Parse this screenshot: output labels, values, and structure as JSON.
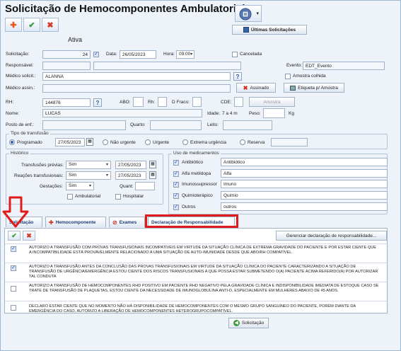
{
  "window": {
    "title": "Solicitação de Hemocomponentes Ambulatorial"
  },
  "toolbar": {
    "add_glyph": "✚",
    "confirm_glyph": "✔",
    "cancel_glyph": "✖",
    "last_requests_label": "Últimas Solicitações"
  },
  "status": "Ativa",
  "form": {
    "solicitacao_label": "Solicitação:",
    "solicitacao_value": "24",
    "data_label": "Data:",
    "data_value": "26/05/2023",
    "hora_label": "Hora:",
    "hora_value": "09:00",
    "cancelada_label": "Cancelada",
    "responsavel_label": "Responsável:",
    "evento_label": "Evento:",
    "evento_value": "EDT_Evento",
    "medico_solicit_label": "Médico solicit.:",
    "medico_solicit_value": "ALANNA",
    "amostra_colhida_label": "Amostra colhida",
    "medico_assin_label": "Médico assin.:",
    "assinado_label": "Assinado",
    "etiqueta_label": "Etiqueta p/ Amostra",
    "rh_label": "RH:",
    "rh_value": "144876",
    "abo_label": "ABO:",
    "rh2_label": "Rh:",
    "dfraco_label": "D Fraco:",
    "cde_label": "CDE:",
    "amostra_label": "Amostra",
    "nome_label": "Nome:",
    "nome_value": "LUCAS",
    "idade_label": "Idade:",
    "idade_value": "7 a 4 m",
    "peso_label": "Peso:",
    "peso_unit": "Kg",
    "posto_label": "Posto de enf.:",
    "quarto_label": "Quarto:",
    "leito_label": "Leito:"
  },
  "tipo_transfusao": {
    "title": "Tipo de transfusão",
    "programado_label": "Programado",
    "programado_date": "27/05/2023",
    "nao_urgente_label": "Não urgente",
    "urgente_label": "Urgente",
    "extrema_label": "Extrema urgência",
    "reserva_label": "Reserva"
  },
  "historico": {
    "title": "Histórico",
    "transfusoes_label": "Transfusões prévias:",
    "transfusoes_value": "Sim",
    "transfusoes_date": "27/05/2023",
    "reacoes_label": "Reações transfusionais:",
    "reacoes_value": "Sim",
    "reacoes_date": "27/05/2023",
    "gestacoes_label": "Gestações:",
    "gestacoes_value": "Sim",
    "quant_label": "Quant:",
    "ambulatorial_label": "Ambulatorial",
    "hospitalar_label": "Hospitalar"
  },
  "medicamentos": {
    "title": "Uso de medicamentos",
    "items": [
      {
        "label": "Antibiótico",
        "value": "Antibiótico",
        "checked": true
      },
      {
        "label": "Alfa metildopa",
        "value": "Alfa",
        "checked": true
      },
      {
        "label": "Imunossupressor",
        "value": "Imuno",
        "checked": true
      },
      {
        "label": "Quimioterápico",
        "value": "Quimio",
        "checked": true
      },
      {
        "label": "Outros",
        "value": "outros",
        "checked": true
      }
    ]
  },
  "tabs": [
    {
      "label": "Solicitação"
    },
    {
      "label": "Hemocomponente"
    },
    {
      "label": "Exames"
    },
    {
      "label": "Declaração de Responsabilidade"
    }
  ],
  "panel": {
    "gerenciar_label": "Gerenciar declaração de responsabilidade...",
    "declarations": [
      {
        "checked": true,
        "text": "AUTORIZO A TRANSFUSÃO COM PROVAS TRANSFUSIONAIS INCOMPATÍVEIS EM VIRTUDE DA SITUAÇÃO CLÍNICA DE EXTREMA GRAVIDADE DO PACIENTE E POR ESTAR CIENTE QUE A INCOMPATIBILIDADE ESTÁ PROVAVELMENTE RELACIONADO A UMA SITUAÇÃO DE AUTO-IMUNIDADE DESDE QUE ABO/RH COMPATÍVEL."
      },
      {
        "checked": true,
        "text": "AUTORIZO A TRANSFUSÃO ANTES DA CONCLUSÃO DAS PROVAS TRANSFUSIONAIS EM VIRTUDE DA SITUAÇÃO CLÍNICA DO PACIENTE CARACTERIZANDO A SITUAÇÃO DE TRANSFUSÃO DE URGÊNCIA/EMERGÊNCIA ESTOU CIENTE DOS RISCOS TRANSFUSIONAIS A QUE POSSA ESTAR SUBMETENDO O(A) PACIENTE ACIMA REFERIDO(A) POR AUTORIZAR TAL CONDUTA"
      },
      {
        "checked": false,
        "text": "AUTORIZO A TRANSFUSÃO DE HEMOCOMPONENTES RHD POSITIVO EM PACIENTE RHD NEGATIVO PELA GRAVIDADE CLÍNICA E INDISPONIBILIDADE IMEDIATA DE ESTOQUE CASO SE TRATE DE TRANSFUSÃO DE PLAQUETAS, ESTOU CIENTE DA NECESSIDADE DE IMUNOGLOBULINA ANTI-D, ESPECIALMENTE EM MULHERES ABAIXO DE 45 ANOS."
      },
      {
        "checked": false,
        "text": "DECLARO ESTAR CIENTE QUE NO MOMENTO NÃO HÁ DISPONIBILIDADE DE HEMOCOMPONENTES COM O MESMO GRUPO SANGUÍNEO DO PACIENTE, PORÉM DIANTE DA EMERGÊNCIA DO CASO, AUTORIZO A LIBERAÇÃO DE HEMOCOMPONENTES HETEROGRUPOCOMPATÍVEL."
      }
    ]
  },
  "footer": {
    "solicitacao_button": "Solicitação"
  },
  "colors": {
    "highlight_red": "#e11b1b",
    "accent_blue": "#2a5db0"
  }
}
